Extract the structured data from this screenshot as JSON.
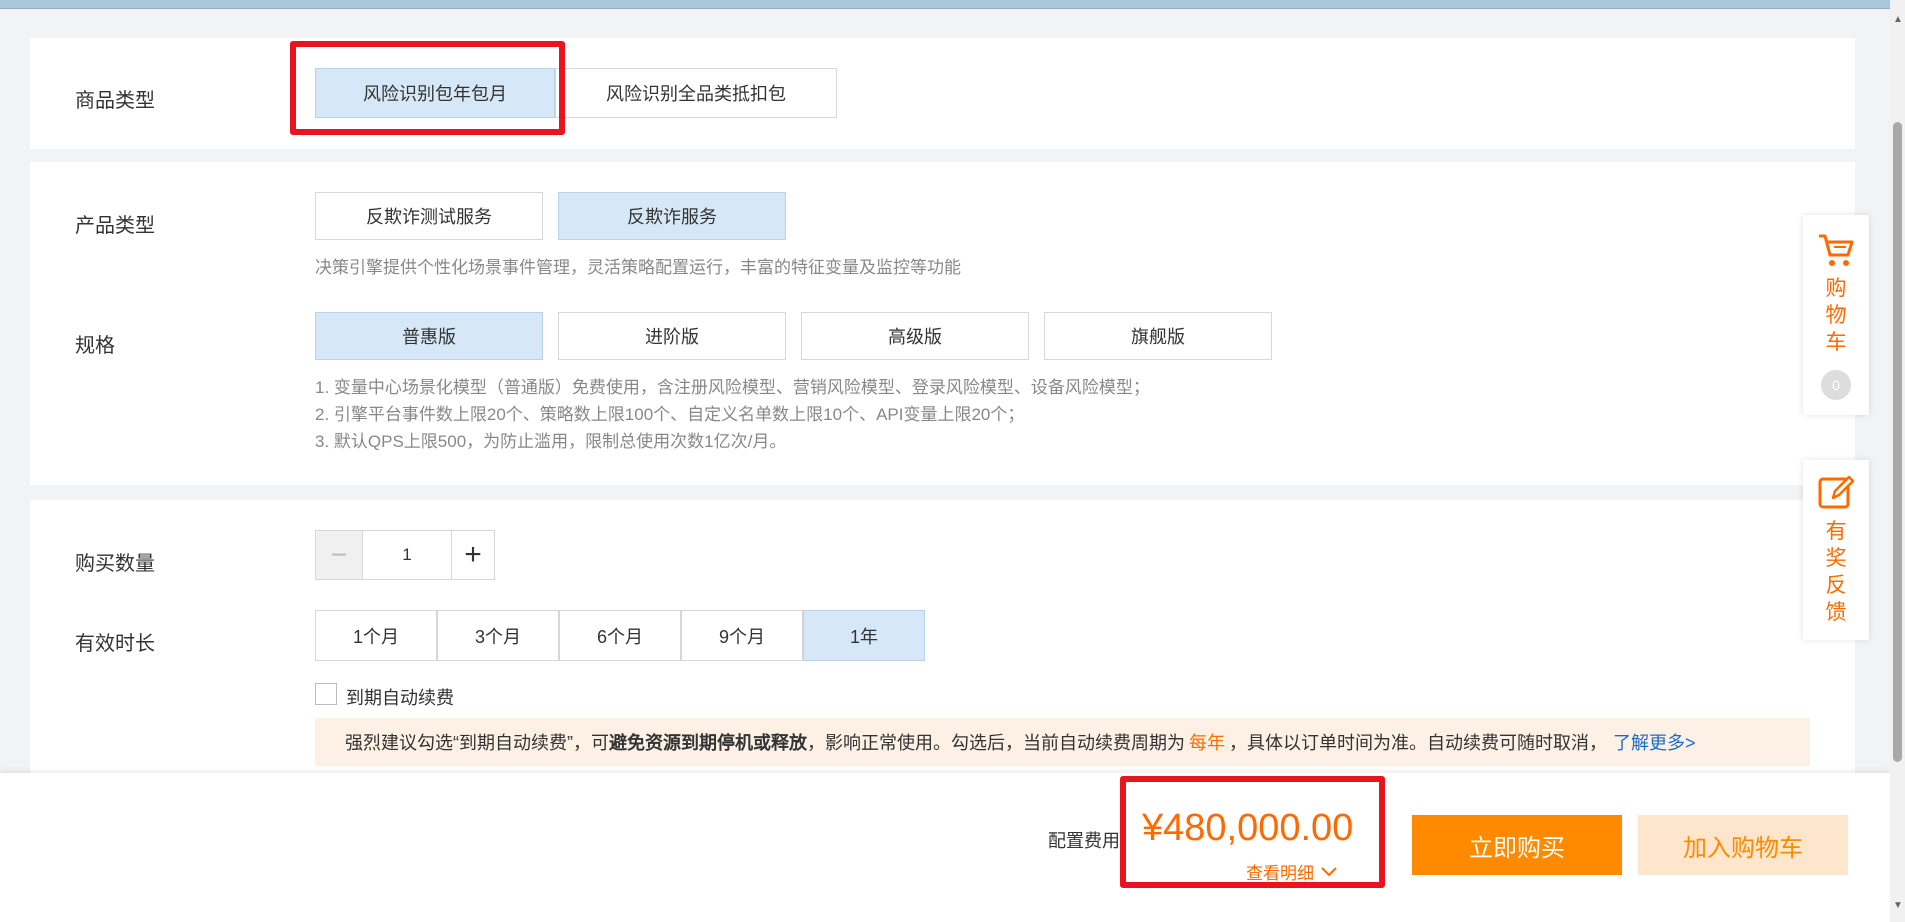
{
  "product_type_section": {
    "label": "商品类型",
    "options": [
      "风险识别包年包月",
      "风险识别全品类抵扣包"
    ]
  },
  "config_section": {
    "product_label": "产品类型",
    "product_options": [
      "反欺诈测试服务",
      "反欺诈服务"
    ],
    "product_desc": "决策引擎提供个性化场景事件管理，灵活策略配置运行，丰富的特征变量及监控等功能",
    "spec_label": "规格",
    "spec_options": [
      "普惠版",
      "进阶版",
      "高级版",
      "旗舰版"
    ],
    "spec_desc": [
      "1. 变量中心场景化模型（普通版）免费使用，含注册风险模型、营销风险模型、登录风险模型、设备风险模型；",
      "2. 引擎平台事件数上限20个、策略数上限100个、自定义名单数上限10个、API变量上限20个；",
      "3. 默认QPS上限500，为防止滥用，限制总使用次数1亿次/月。"
    ]
  },
  "purchase_section": {
    "quantity_label": "购买数量",
    "quantity": "1",
    "minus": "−",
    "plus": "+",
    "duration_label": "有效时长",
    "durations": [
      "1个月",
      "3个月",
      "6个月",
      "9个月",
      "1年"
    ],
    "auto_renew_label": "到期自动续费",
    "notice": {
      "part1": "强烈建议勾选“到期自动续费”，可",
      "bold": "避免资源到期停机或释放",
      "part2": "，影响正常使用。勾选后，当前自动续费周期为",
      "period": "每年",
      "part3": "，具体以订单时间为准。自动续费可随时取消，",
      "link": "了解更多>"
    }
  },
  "footer": {
    "fee_label": "配置费用",
    "price": "¥480,000.00",
    "detail_link": "查看明细",
    "buy_button": "立即购买",
    "cart_button": "加入购物车"
  },
  "side": {
    "cart_text": "购物车",
    "cart_count": "0",
    "feedback_text": "有奖反馈"
  },
  "colors": {
    "accent": "#ff8a00",
    "selected_bg": "#d6e8f7",
    "highlight_red": "#e8141f",
    "link": "#1c6cc8"
  }
}
